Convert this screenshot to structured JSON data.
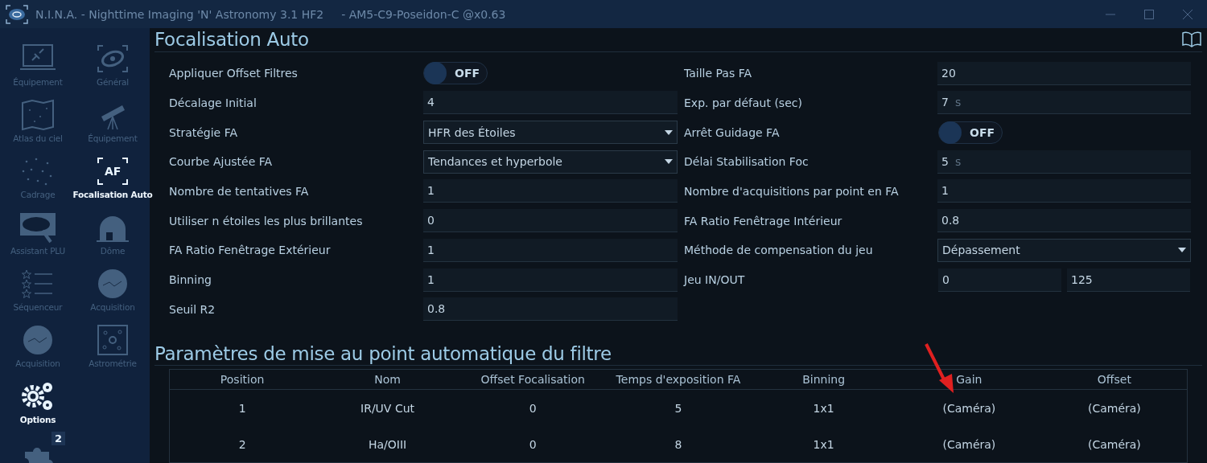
{
  "window": {
    "title": "N.I.N.A. - Nighttime Imaging 'N' Astronomy 3.1 HF2",
    "profile": "-  AM5-C9-Poseidon-C @x0.63"
  },
  "nav": {
    "columns": [
      [
        {
          "label": "Équipement",
          "kind": "laptop",
          "selected": false
        },
        {
          "label": "Atlas du ciel",
          "kind": "map",
          "selected": false
        },
        {
          "label": "Cadrage",
          "kind": "starfield",
          "selected": false
        },
        {
          "label": "Assistant PLU",
          "kind": "panel",
          "selected": false
        },
        {
          "label": "Séquenceur",
          "kind": "list",
          "selected": false
        },
        {
          "label": "Acquisition",
          "kind": "sphere",
          "selected": false
        },
        {
          "label": "Options",
          "kind": "gears",
          "selected": true
        },
        {
          "kind": "puzzle",
          "badge": "2",
          "selected": false
        }
      ],
      [
        {
          "label": "Général",
          "kind": "galaxy",
          "selected": false
        },
        {
          "label": "Équipement",
          "kind": "telescope",
          "selected": false
        },
        {
          "label": "Focalisation Auto",
          "kind": "frame",
          "icon_text": "AF",
          "selected": true
        },
        {
          "label": "Dôme",
          "kind": "dome",
          "selected": false
        },
        {
          "label": "Acquisition",
          "kind": "sphere",
          "selected": false
        },
        {
          "label": "Astrométrie",
          "kind": "plate",
          "selected": false
        }
      ]
    ]
  },
  "page": {
    "title": "Focalisation Auto"
  },
  "settings": {
    "left": [
      {
        "kind": "toggle",
        "label": "Appliquer Offset Filtres",
        "on": false,
        "text": "OFF"
      },
      {
        "kind": "field",
        "label": "Décalage Initial",
        "value": "4"
      },
      {
        "kind": "dropdown",
        "label": "Stratégie FA",
        "value": "HFR des Étoiles"
      },
      {
        "kind": "dropdown",
        "label": "Courbe Ajustée FA",
        "value": "Tendances et hyperbole"
      },
      {
        "kind": "field",
        "label": "Nombre de tentatives FA",
        "value": "1"
      },
      {
        "kind": "field",
        "label": "Utiliser n étoiles les plus brillantes",
        "value": "0"
      },
      {
        "kind": "field",
        "label": "FA Ratio Fenêtrage Extérieur",
        "value": "1"
      },
      {
        "kind": "field",
        "label": "Binning",
        "value": "1"
      },
      {
        "kind": "field",
        "label": "Seuil R2",
        "value": "0.8"
      }
    ],
    "right": [
      {
        "kind": "field",
        "label": "Taille Pas FA",
        "value": "20"
      },
      {
        "kind": "field",
        "label": "Exp. par défaut (sec)",
        "value": "7",
        "unit": "s"
      },
      {
        "kind": "toggle",
        "label": "Arrêt Guidage FA",
        "on": false,
        "text": "OFF"
      },
      {
        "kind": "field",
        "label": "Délai Stabilisation Foc",
        "value": "5",
        "unit": "s"
      },
      {
        "kind": "field",
        "label": "Nombre d'acquisitions par point en FA",
        "value": "1"
      },
      {
        "kind": "field",
        "label": "FA Ratio Fenêtrage Intérieur",
        "value": "0.8"
      },
      {
        "kind": "dropdown",
        "label": "Méthode de compensation du jeu",
        "value": "Dépassement"
      },
      {
        "kind": "pair",
        "label": "Jeu IN/OUT",
        "values": [
          "0",
          "125"
        ]
      }
    ]
  },
  "filters": {
    "title": "Paramètres de mise au point automatique du filtre",
    "columns": [
      "Position",
      "Nom",
      "Offset Focalisation",
      "Temps d'exposition FA",
      "Binning",
      "Gain",
      "Offset"
    ],
    "rows": [
      [
        "1",
        "IR/UV Cut",
        "0",
        "5",
        "1x1",
        "(Caméra)",
        "(Caméra)"
      ],
      [
        "2",
        "Ha/OIII",
        "0",
        "8",
        "1x1",
        "(Caméra)",
        "(Caméra)"
      ]
    ]
  }
}
